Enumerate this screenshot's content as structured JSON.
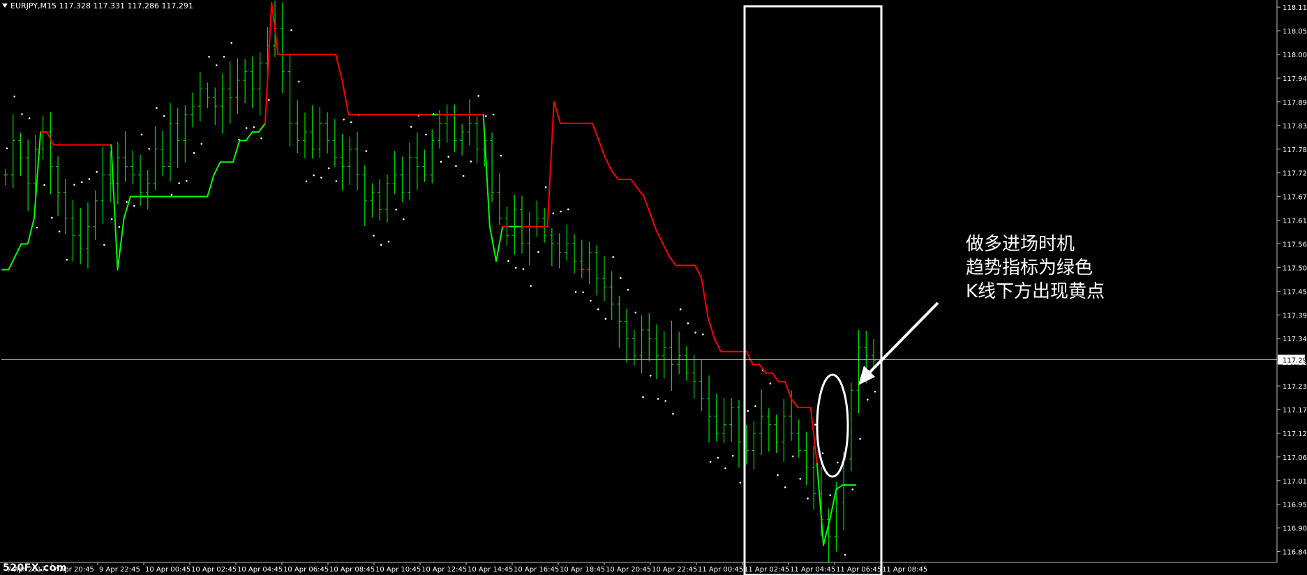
{
  "header": {
    "symbol": "EURJPY,M15",
    "quote": "117.328 117.331 117.286 117.291"
  },
  "annotation": {
    "line1": "做多进场时机",
    "line2": "趋势指标为绿色",
    "line3": "K线下方出现黄点"
  },
  "watermark": "520FX.com",
  "colors": {
    "background": "#000000",
    "bars": "#00e000",
    "trend_up": "#00ff00",
    "trend_down": "#ff0000",
    "dots": "#ffffff",
    "annotation": "#ffffff"
  },
  "chart_data": {
    "type": "line",
    "title": "EURJPY,M15",
    "ylim": [
      116.82,
      118.12
    ],
    "current_price": 117.291,
    "current_price_label": "117.291",
    "y_ticks": [
      "118.110",
      "118.055",
      "118.000",
      "117.945",
      "117.890",
      "117.835",
      "117.780",
      "117.725",
      "117.670",
      "117.615",
      "117.560",
      "117.505",
      "117.450",
      "117.395",
      "117.340",
      "117.285",
      "117.230",
      "117.175",
      "117.120",
      "117.065",
      "117.010",
      "116.955",
      "116.900",
      "116.845"
    ],
    "x_ticks": [
      "7 Apr 2017",
      "7 Apr 20:45",
      "9 Apr 22:45",
      "10 Apr 00:45",
      "10 Apr 02:45",
      "10 Apr 04:45",
      "10 Apr 06:45",
      "10 Apr 08:45",
      "10 Apr 10:45",
      "10 Apr 12:45",
      "10 Apr 14:45",
      "10 Apr 16:45",
      "10 Apr 18:45",
      "10 Apr 20:45",
      "10 Apr 22:45",
      "11 Apr 00:45",
      "11 Apr 02:45",
      "11 Apr 04:45",
      "11 Apr 06:45",
      "11 Apr 08:45"
    ],
    "close": [
      117.72,
      117.8,
      117.76,
      117.7,
      117.78,
      117.82,
      117.74,
      117.68,
      117.62,
      117.58,
      117.55,
      117.6,
      117.66,
      117.72,
      117.7,
      117.76,
      117.74,
      117.72,
      117.68,
      117.7,
      117.78,
      117.74,
      117.84,
      117.8,
      117.86,
      117.88,
      117.92,
      117.9,
      117.88,
      117.92,
      117.9,
      117.94,
      117.96,
      117.92,
      117.98,
      118.02,
      118.06,
      117.96,
      117.84,
      117.8,
      117.82,
      117.78,
      117.84,
      117.8,
      117.76,
      117.74,
      117.78,
      117.72,
      117.66,
      117.68,
      117.64,
      117.7,
      117.72,
      117.68,
      117.76,
      117.74,
      117.72,
      117.8,
      117.84,
      117.86,
      117.8,
      117.82,
      117.84,
      117.78,
      117.8,
      117.68,
      117.62,
      117.58,
      117.64,
      117.56,
      117.6,
      117.62,
      117.58,
      117.56,
      117.54,
      117.56,
      117.52,
      117.5,
      117.54,
      117.48,
      117.46,
      117.42,
      117.38,
      117.34,
      117.3,
      117.36,
      117.34,
      117.3,
      117.32,
      117.28,
      117.3,
      117.26,
      117.24,
      117.2,
      117.16,
      117.12,
      117.14,
      117.18,
      117.1,
      117.08,
      117.12,
      117.16,
      117.14,
      117.1,
      117.16,
      117.12,
      117.08,
      117.04,
      116.98,
      116.92,
      116.88,
      116.96,
      117.06,
      117.22,
      117.32,
      117.3,
      117.29
    ],
    "trend_line": {
      "colors_note": "",
      "values": [
        117.5,
        117.5,
        117.53,
        117.56,
        117.56,
        117.62,
        117.82,
        117.82,
        117.79,
        117.79,
        117.79,
        117.79,
        117.79,
        117.79,
        117.79,
        117.79,
        117.79,
        117.79,
        117.5,
        117.62,
        117.67,
        117.67,
        117.67,
        117.67,
        117.67,
        117.67,
        117.67,
        117.67,
        117.67,
        117.67,
        117.67,
        117.67,
        117.67,
        117.72,
        117.75,
        117.75,
        117.75,
        117.8,
        117.8,
        117.82,
        117.82,
        117.84,
        118.12,
        118.0,
        118.0,
        118.0,
        118.0,
        118.0,
        118.0,
        118.0,
        118.0,
        118.0,
        118.0,
        117.94,
        117.86,
        117.86,
        117.86,
        117.86,
        117.86,
        117.86,
        117.86,
        117.86,
        117.86,
        117.86,
        117.86,
        117.86,
        117.86,
        117.86,
        117.86,
        117.86,
        117.86,
        117.86,
        117.86,
        117.86,
        117.86,
        117.86,
        117.6,
        117.52,
        117.6,
        117.6,
        117.6,
        117.6,
        117.6,
        117.6,
        117.6,
        117.6,
        117.89,
        117.84,
        117.84,
        117.84,
        117.84,
        117.84,
        117.84,
        117.8,
        117.76,
        117.73,
        117.71,
        117.71,
        117.71,
        117.69,
        117.67,
        117.63,
        117.59,
        117.56,
        117.53,
        117.51,
        117.51,
        117.51,
        117.51,
        117.48,
        117.39,
        117.34,
        117.31,
        117.31,
        117.31,
        117.31,
        117.31,
        117.28,
        117.28,
        117.26,
        117.26,
        117.24,
        117.24,
        117.2,
        117.18,
        117.18,
        117.18,
        117.05,
        116.86,
        116.92,
        116.99,
        117.0,
        117.0,
        117.0
      ]
    }
  }
}
